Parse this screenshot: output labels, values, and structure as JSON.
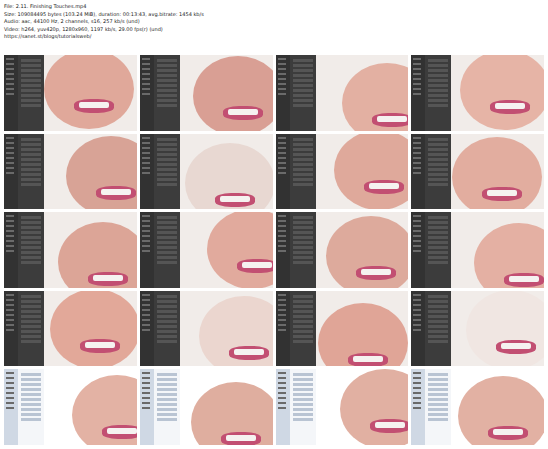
{
  "header": [
    "File: 2.11. Finishing Touches.mp4",
    "Size: 109084495 bytes (103.24 MiB), duration: 00:13:43, avg.bitrate: 1454 kb/s",
    "Audio: aac, 44100 Hz, 2 channels, s16, 257 kb/s (und)",
    "Video: h264, yuv420p, 1280x960, 1197 kb/s, 29.00 fps(r) (und)",
    "https://sanet.st/blogs/tutorialsweb/"
  ],
  "frames": [
    {
      "kind": "dark",
      "color": "#e0a89a"
    },
    {
      "kind": "dark",
      "color": "#d99f94"
    },
    {
      "kind": "dark",
      "color": "#e3b0a2"
    },
    {
      "kind": "dark",
      "color": "#e6b4a6"
    },
    {
      "kind": "dark",
      "color": "#d8a396"
    },
    {
      "kind": "dark",
      "color": "#e8d8d2"
    },
    {
      "kind": "dark",
      "color": "#dfa99b"
    },
    {
      "kind": "dark",
      "color": "#e2ad9f"
    },
    {
      "kind": "dark",
      "color": "#dca597"
    },
    {
      "kind": "dark",
      "color": "#e1aa9d"
    },
    {
      "kind": "dark",
      "color": "#ddaa9c"
    },
    {
      "kind": "dark",
      "color": "#e4b0a3"
    },
    {
      "kind": "dark",
      "color": "#e2a899"
    },
    {
      "kind": "dark",
      "color": "#ebd6cf"
    },
    {
      "kind": "dark",
      "color": "#e0a597"
    },
    {
      "kind": "dark",
      "color": "#f0e6e2"
    },
    {
      "kind": "light",
      "color": "#e3b2a4"
    },
    {
      "kind": "light",
      "color": "#dfae9f"
    },
    {
      "kind": "light",
      "color": "#e1b0a2"
    },
    {
      "kind": "light",
      "color": "#e2b1a3"
    }
  ]
}
